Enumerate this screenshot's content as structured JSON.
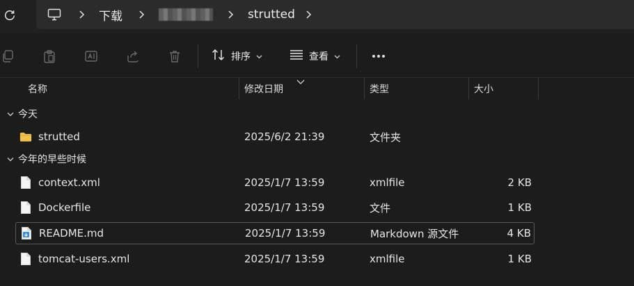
{
  "address": {
    "crumbs": [
      "下载",
      "strutted"
    ]
  },
  "toolbar": {
    "sort_label": "排序",
    "view_label": "查看"
  },
  "columns": {
    "name": "名称",
    "date": "修改日期",
    "type": "类型",
    "size": "大小"
  },
  "groups": [
    {
      "label": "今天",
      "rows": [
        {
          "name": "strutted",
          "date": "2025/6/2 21:39",
          "type": "文件夹",
          "size": "",
          "icon": "folder-icon"
        }
      ]
    },
    {
      "label": "今年的早些时候",
      "rows": [
        {
          "name": "context.xml",
          "date": "2025/1/7 13:59",
          "type": "xmlfile",
          "size": "2 KB",
          "icon": "file-icon"
        },
        {
          "name": "Dockerfile",
          "date": "2025/1/7 13:59",
          "type": "文件",
          "size": "1 KB",
          "icon": "file-icon"
        },
        {
          "name": "README.md",
          "date": "2025/1/7 13:59",
          "type": "Markdown 源文件",
          "size": "4 KB",
          "icon": "markdown-file-icon"
        },
        {
          "name": "tomcat-users.xml",
          "date": "2025/1/7 13:59",
          "type": "xmlfile",
          "size": "1 KB",
          "icon": "file-icon"
        }
      ]
    }
  ],
  "colors": {
    "background": "#1c1c1c",
    "address_bar": "#2b2b2b",
    "folder": "#f2c14e",
    "accent": "#4cc2ff"
  }
}
